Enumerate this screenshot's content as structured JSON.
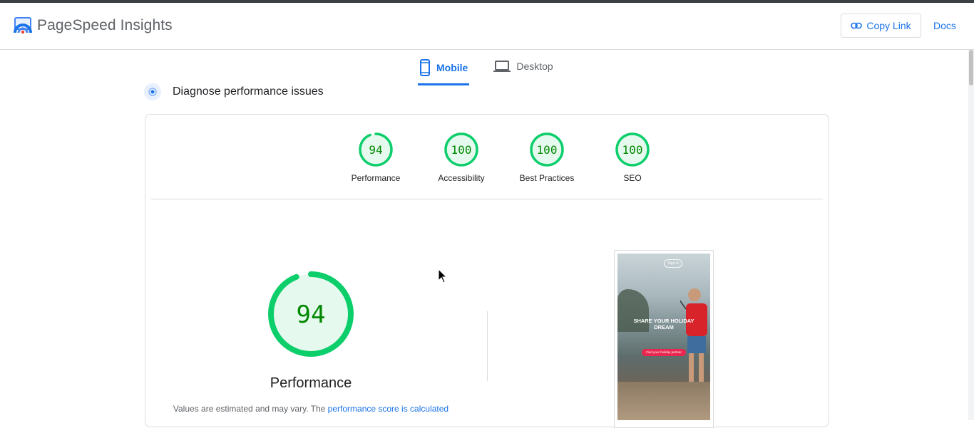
{
  "header": {
    "brand": "PageSpeed Insights",
    "copy_link_label": "Copy Link",
    "docs_label": "Docs"
  },
  "tabs": [
    {
      "label": "Mobile",
      "icon": "phone-icon",
      "active": true
    },
    {
      "label": "Desktop",
      "icon": "laptop-icon",
      "active": false
    }
  ],
  "section": {
    "title": "Diagnose performance issues"
  },
  "scores": [
    {
      "value": "94",
      "label": "Performance",
      "score": 94
    },
    {
      "value": "100",
      "label": "Accessibility",
      "score": 100
    },
    {
      "value": "100",
      "label": "Best Practices",
      "score": 100
    },
    {
      "value": "100",
      "label": "SEO",
      "score": 100
    }
  ],
  "main_score": {
    "value": "94",
    "score": 94,
    "title": "Performance",
    "note_prefix": "Values are estimated and may vary. The ",
    "note_link": "performance score is calculated"
  },
  "screenshot": {
    "signin": "Sign in",
    "headline": "SHARE YOUR HOLIDAY DREAM",
    "cta": "Find your holiday partner"
  },
  "colors": {
    "pass_green": "#0cce6b",
    "pass_green_text": "#008800",
    "pass_green_bg": "#e6f9ee",
    "link_blue": "#1a73e8"
  }
}
